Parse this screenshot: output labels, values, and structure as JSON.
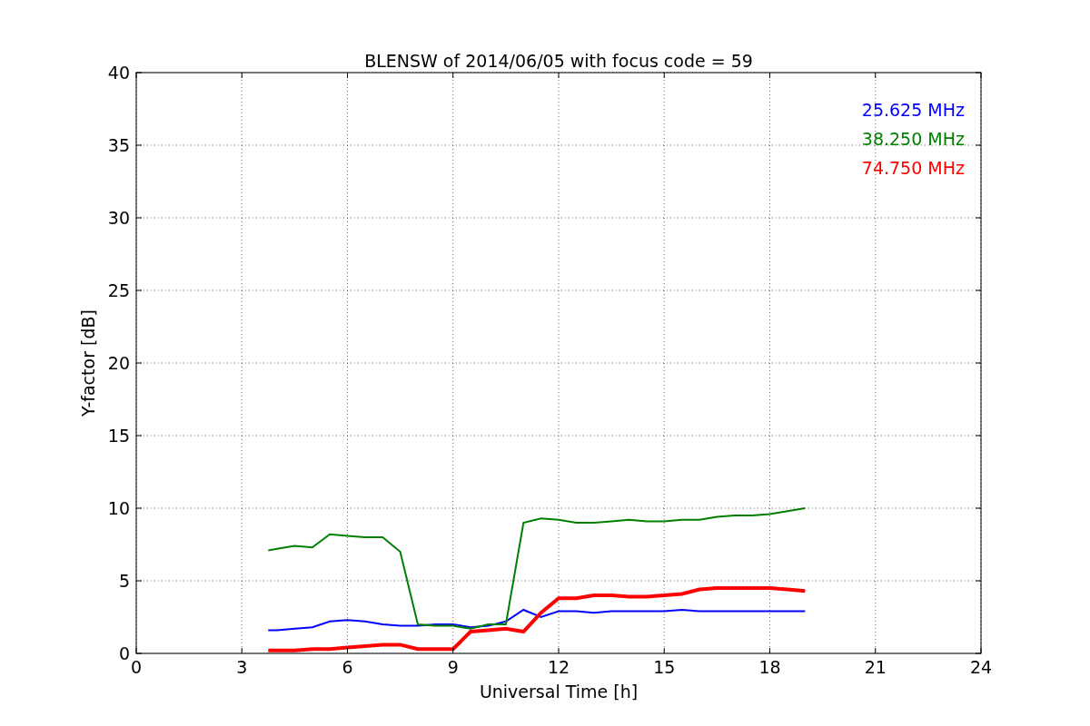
{
  "figure": {
    "chart_data": {
      "type": "line",
      "title": "BLENSW of 2014/06/05 with focus code = 59",
      "xlabel": "Universal Time [h]",
      "ylabel": "Y-factor [dB]",
      "x": [
        3.75,
        4,
        4.5,
        5,
        5.5,
        6,
        6.5,
        7,
        7.5,
        8,
        8.5,
        9,
        9.5,
        10,
        10.5,
        11,
        11.5,
        12,
        12.5,
        13,
        13.5,
        14,
        14.5,
        15,
        15.5,
        16,
        16.5,
        17,
        17.5,
        18,
        18.5,
        19
      ],
      "series": [
        {
          "name": "25.625 MHz",
          "color": "#0000ff",
          "values": [
            1.6,
            1.6,
            1.7,
            1.8,
            2.2,
            2.3,
            2.2,
            2.0,
            1.9,
            1.9,
            2.0,
            2.0,
            1.8,
            1.9,
            2.2,
            3.0,
            2.5,
            2.9,
            2.9,
            2.8,
            2.9,
            2.9,
            2.9,
            2.9,
            3.0,
            2.9,
            2.9,
            2.9,
            2.9,
            2.9,
            2.9,
            2.9
          ]
        },
        {
          "name": "38.250 MHz",
          "color": "#008000",
          "values": [
            7.1,
            7.2,
            7.4,
            7.3,
            8.2,
            8.1,
            8.0,
            8.0,
            7.0,
            2.0,
            1.9,
            1.9,
            1.7,
            2.0,
            2.0,
            9.0,
            9.3,
            9.2,
            9.0,
            9.0,
            9.1,
            9.2,
            9.1,
            9.1,
            9.2,
            9.2,
            9.4,
            9.5,
            9.5,
            9.6,
            9.8,
            10.0
          ]
        },
        {
          "name": "74.750 MHz",
          "color": "#ff0000",
          "values": [
            0.2,
            0.2,
            0.2,
            0.3,
            0.3,
            0.4,
            0.5,
            0.6,
            0.6,
            0.3,
            0.3,
            0.3,
            1.5,
            1.6,
            1.7,
            1.5,
            2.8,
            3.8,
            3.8,
            4.0,
            4.0,
            3.9,
            3.9,
            4.0,
            4.1,
            4.4,
            4.5,
            4.5,
            4.5,
            4.5,
            4.4,
            4.3
          ]
        }
      ],
      "xlim": [
        0,
        24
      ],
      "ylim": [
        0,
        40
      ],
      "xticks": [
        0,
        3,
        6,
        9,
        12,
        15,
        18,
        21,
        24
      ],
      "yticks": [
        0,
        5,
        10,
        15,
        20,
        25,
        30,
        35,
        40
      ],
      "grid": true
    }
  }
}
